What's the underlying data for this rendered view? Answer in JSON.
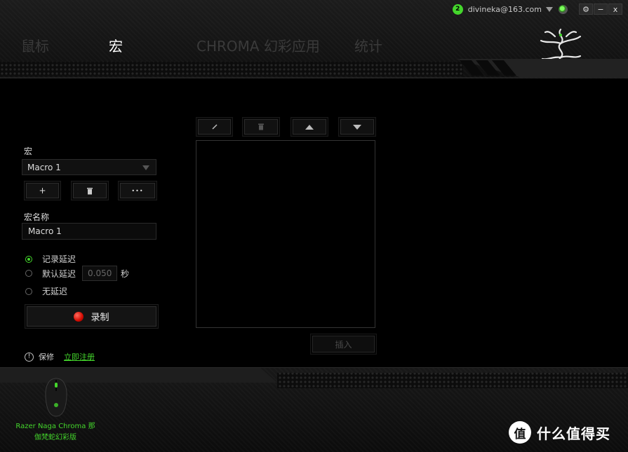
{
  "topbar": {
    "notification_count": "2",
    "user_email": "divineka@163.com",
    "window_buttons": [
      "⚙",
      "−",
      "x"
    ]
  },
  "nav": {
    "tabs": [
      {
        "label": "鼠标",
        "active": false
      },
      {
        "label": "宏",
        "active": true
      },
      {
        "label": "CHROMA 幻彩应用",
        "active": false
      },
      {
        "label": "统计",
        "active": false
      }
    ]
  },
  "macro": {
    "section_label": "宏",
    "selected_macro": "Macro 1",
    "add_label": "+",
    "more_label": "•••",
    "name_label": "宏名称",
    "name_value": "Macro 1",
    "delay_options": [
      {
        "label": "记录延迟",
        "selected": true
      },
      {
        "label": "默认延迟",
        "selected": false
      },
      {
        "label": "无延迟",
        "selected": false
      }
    ],
    "default_delay_value": "0.050",
    "delay_unit": "秒",
    "record_label": "录制"
  },
  "editor": {
    "insert_label": "插入"
  },
  "warranty": {
    "label": "保修",
    "link": "立即注册"
  },
  "device": {
    "name_line1": "Razer Naga Chroma 那",
    "name_line2": "伽梵蛇幻彩版"
  },
  "watermark": {
    "logo_char": "值",
    "text": "什么值得买"
  },
  "colors": {
    "accent": "#44d62c",
    "record": "#d10a00",
    "background": "#000000"
  }
}
